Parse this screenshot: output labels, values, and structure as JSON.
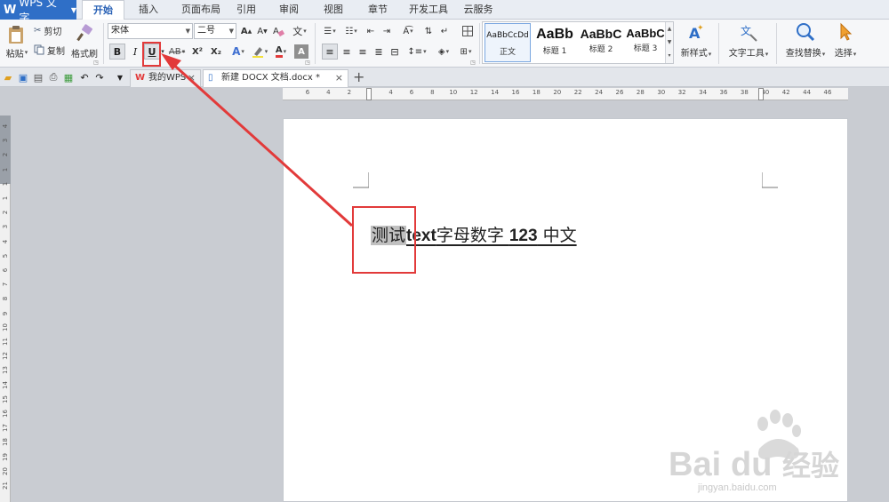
{
  "app": {
    "name": "WPS 文字",
    "logo": "W"
  },
  "menu_tabs": [
    "开始",
    "插入",
    "页面布局",
    "引用",
    "审阅",
    "视图",
    "章节",
    "开发工具",
    "云服务"
  ],
  "active_menu_tab": 0,
  "ribbon": {
    "paste": "粘贴",
    "cut": "剪切",
    "copy": "复制",
    "format_painter": "格式刷",
    "font_name": "宋体",
    "font_size": "二号",
    "bold": "B",
    "italic": "I",
    "underline": "U",
    "strikethrough": "AB",
    "superscript": "X²",
    "subscript": "X₂",
    "highlight": "A",
    "styles": [
      {
        "sample": "AaBbCcDd",
        "name": "正文"
      },
      {
        "sample": "AaBb",
        "name": "标题 1"
      },
      {
        "sample": "AaBbC",
        "name": "标题 2"
      },
      {
        "sample": "AaBbC",
        "name": "标题 3"
      }
    ],
    "new_style": "新样式",
    "text_tools": "文字工具",
    "find_replace": "查找替换",
    "select": "选择"
  },
  "doc_tabs": [
    {
      "label": "我的WPS",
      "active": false
    },
    {
      "label": "新建 DOCX 文档.docx *",
      "active": true
    }
  ],
  "ruler": {
    "h_numbers": [
      "6",
      "4",
      "2",
      "2",
      "4",
      "6",
      "8",
      "10",
      "12",
      "14",
      "16",
      "18",
      "20",
      "22",
      "24",
      "26",
      "28",
      "30",
      "32",
      "34",
      "36",
      "38",
      "40",
      "42",
      "44",
      "46"
    ],
    "v_numbers": [
      "4",
      "3",
      "2",
      "1",
      "1",
      "1",
      "2",
      "3",
      "4",
      "5",
      "6",
      "7",
      "8",
      "9",
      "10",
      "11",
      "12",
      "13",
      "14",
      "15",
      "16",
      "17",
      "18",
      "19",
      "20",
      "21"
    ]
  },
  "document": {
    "selected_text": "测试",
    "bold_text": "text",
    "text_2": "字母数字 ",
    "bold_num": "123",
    "text_3": " 中文"
  },
  "watermark": {
    "brand": "Baidu经验",
    "url": "jingyan.baidu.com"
  },
  "colors": {
    "accent": "#2f6fc7",
    "annotation": "#e23a3a",
    "selection": "#c0c0c0"
  }
}
